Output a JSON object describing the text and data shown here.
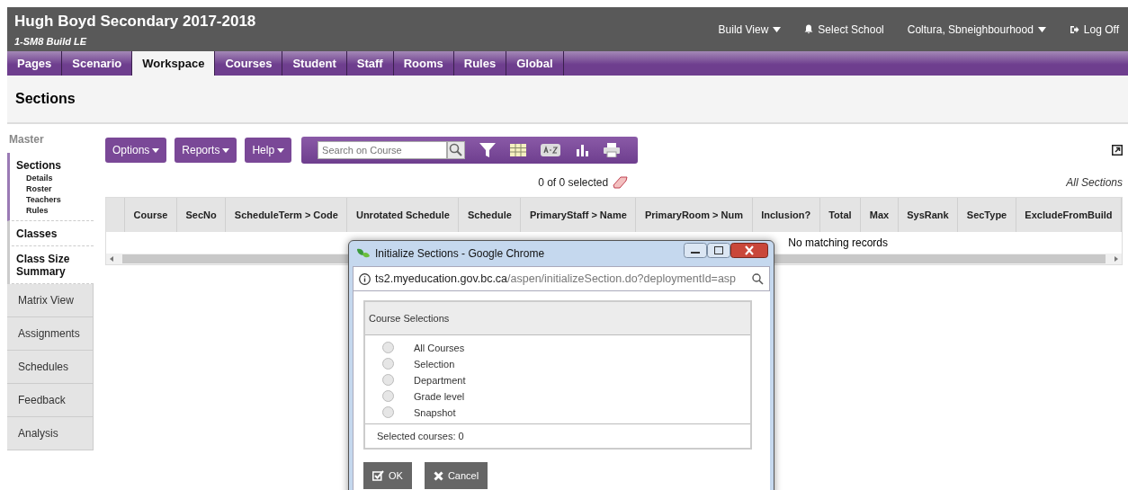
{
  "header": {
    "title": "Hugh Boyd Secondary 2017-2018",
    "subtitle": "1-SM8 Build LE",
    "actions": [
      {
        "kind": "dropdown",
        "label": "Build View"
      },
      {
        "kind": "bell",
        "label": "Select School"
      },
      {
        "kind": "dropdown",
        "label": "Coltura, Sbneighbourhood"
      },
      {
        "kind": "logoff",
        "label": "Log Off"
      }
    ]
  },
  "tabs": [
    {
      "label": "Pages",
      "selected": false
    },
    {
      "label": "Scenario",
      "selected": false
    },
    {
      "label": "Workspace",
      "selected": true
    },
    {
      "label": "Courses",
      "selected": false
    },
    {
      "label": "Student",
      "selected": false
    },
    {
      "label": "Staff",
      "selected": false
    },
    {
      "label": "Rooms",
      "selected": false
    },
    {
      "label": "Rules",
      "selected": false
    },
    {
      "label": "Global",
      "selected": false
    }
  ],
  "page_title": "Sections",
  "sidebar": {
    "heading": "Master",
    "groups": [
      {
        "label": "Sections",
        "selected": true,
        "children": [
          {
            "label": "Details"
          },
          {
            "label": "Roster"
          },
          {
            "label": "Teachers"
          },
          {
            "label": "Rules"
          }
        ]
      },
      {
        "label": "Classes",
        "selected": false
      },
      {
        "label": "Class Size Summary",
        "selected": false
      }
    ],
    "tabs": [
      "Matrix View",
      "Assignments",
      "Schedules",
      "Feedback",
      "Analysis"
    ]
  },
  "toolbar": {
    "menus": [
      "Options",
      "Reports",
      "Help"
    ],
    "search": {
      "placeholder": "Search on Course"
    }
  },
  "selection_count": "0 of 0 selected",
  "filter_label": "All Sections",
  "table": {
    "columns": [
      "Course",
      "SecNo",
      "ScheduleTerm > Code",
      "Unrotated Schedule",
      "Schedule",
      "PrimaryStaff > Name",
      "PrimaryRoom > Num",
      "Inclusion?",
      "Total",
      "Max",
      "SysRank",
      "SecType",
      "ExcludeFromBuild"
    ],
    "empty_message": "No matching records"
  },
  "popup": {
    "title": "Initialize Sections - Google Chrome",
    "url_host": "ts2.myeducation.gov.bc.ca",
    "url_path": "/aspen/initializeSection.do?deploymentId=asp",
    "panel_title": "Course Selections",
    "options": [
      {
        "label": "All Courses",
        "selected": false
      },
      {
        "label": "Selection",
        "selected": false
      },
      {
        "label": "Department",
        "selected": false
      },
      {
        "label": "Grade level",
        "selected": false
      },
      {
        "label": "Snapshot",
        "selected": false
      }
    ],
    "selected_courses": "Selected courses:  0",
    "buttons": [
      {
        "kind": "ok",
        "label": "OK"
      },
      {
        "kind": "cancel",
        "label": "Cancel"
      }
    ]
  }
}
